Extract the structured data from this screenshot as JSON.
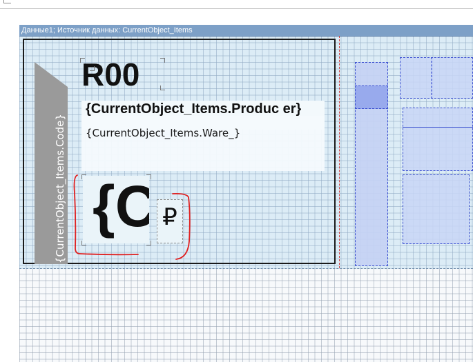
{
  "band": {
    "header": "Данные1; Источник данных: CurrentObject_Items"
  },
  "card": {
    "code_field": "{CurrentObject_Items.Code}",
    "price_field": "R00",
    "product_field": "{CurrentObject_Items.Produc er}",
    "ware_field": "{CurrentObject_Items.Ware_}",
    "big_price_field": "{C",
    "currency_field": "₽"
  },
  "colors": {
    "band_header": "#7da0c7",
    "band_area": "#dcecf6",
    "annotation": "#e02020",
    "panel_border": "#3a4fd0"
  }
}
